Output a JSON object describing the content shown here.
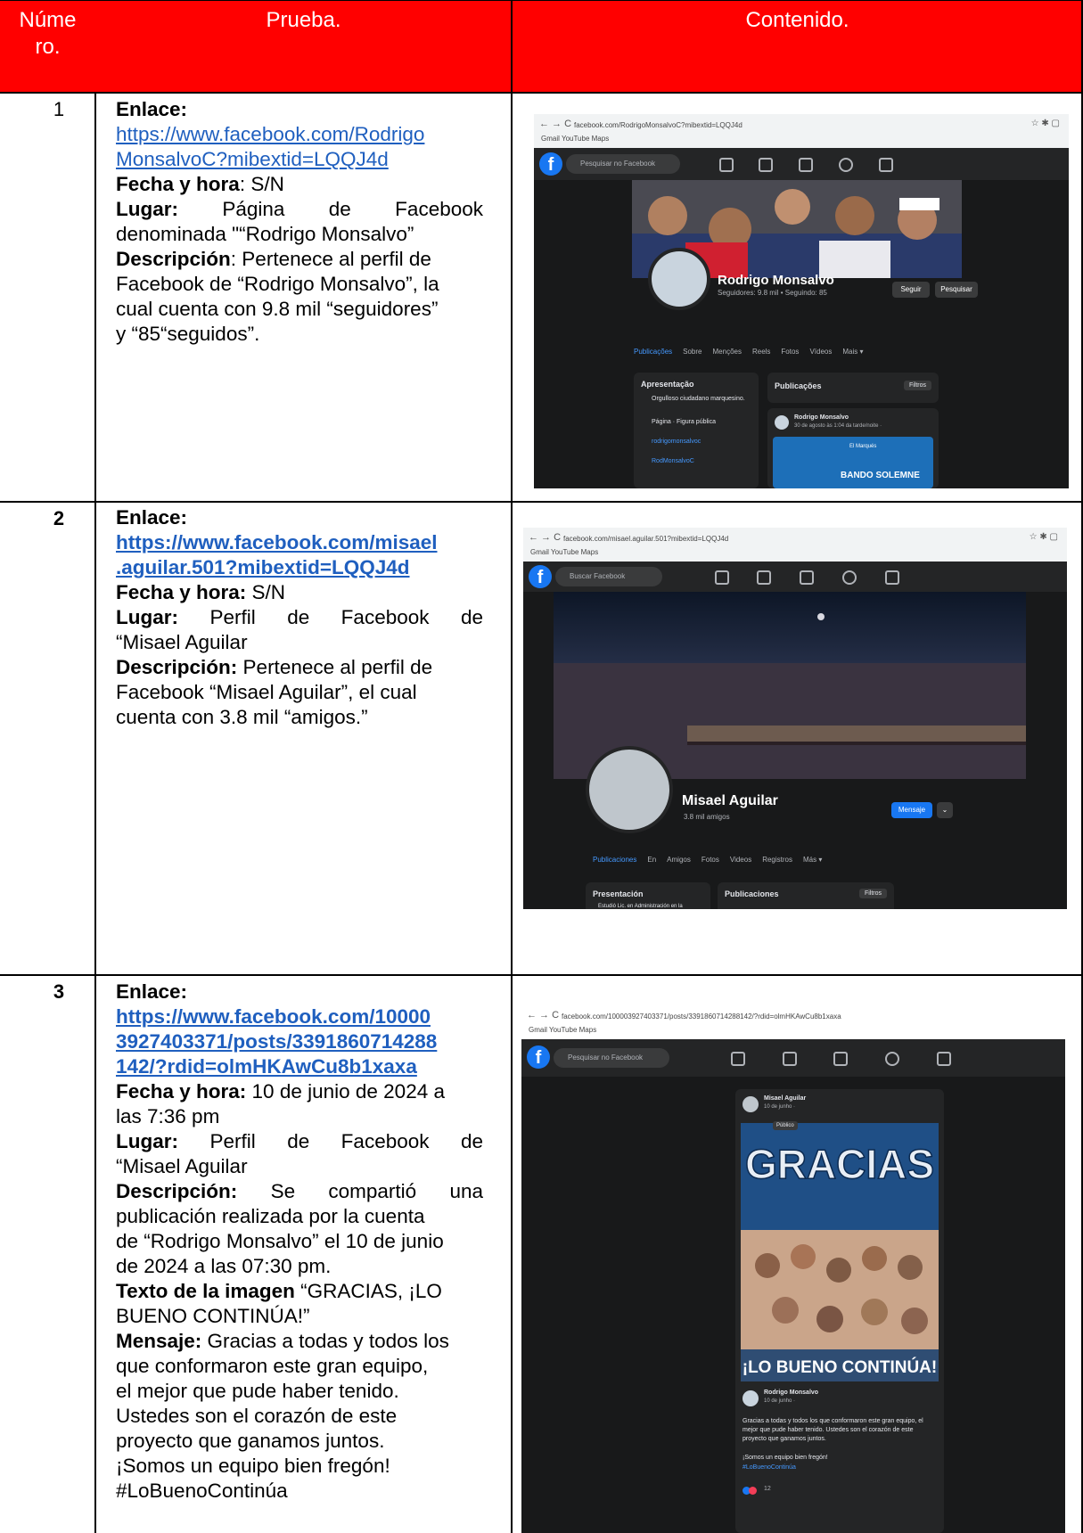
{
  "header": {
    "col_num": "Núme ro.",
    "col_num_l1": "Núme",
    "col_num_l2": "ro.",
    "col_prueba": "Prueba.",
    "col_contenido": "Contenido."
  },
  "rows": [
    {
      "number": "1",
      "enlace_label": "Enlace:",
      "link_line1": "https://www.facebook.com/Rodrigo",
      "link_line2": "MonsalvoC?mibextid=LQQJ4d",
      "fecha_label": "Fecha y hora",
      "fecha_value": ": S/N",
      "lugar_label": "Lugar:",
      "lugar_value": "Página de Facebook",
      "lugar_value2": "denominada \"“Rodrigo Monsalvo”",
      "desc_label": "Descripción",
      "desc_line1": ": Pertenece al perfil de",
      "desc_line2": "Facebook de “Rodrigo Monsalvo”, la",
      "desc_line3": "cual cuenta con 9.8 mil “seguidores”",
      "desc_line4": "y “85“seguidos”.",
      "screenshot": {
        "url": "facebook.com/RodrigoMonsalvoC?mibextid=LQQJ4d",
        "bookmarks": "Gmail   YouTube   Maps",
        "search": "Pesquisar no Facebook",
        "name": "Rodrigo Monsalvo",
        "sub": "Seguidores: 9.8 mil • Seguindo: 85",
        "btn_follow": "Seguir",
        "btn_search": "Pesquisar",
        "tabs": [
          "Publicações",
          "Sobre",
          "Menções",
          "Reels",
          "Fotos",
          "Vídeos",
          "Mais ▾"
        ],
        "intro_title": "Apresentação",
        "intro_text": "Orgulloso ciudadano marquesino.",
        "intro_items": [
          "Página · Figura pública",
          "rodrigomonsalvoc",
          "RodMonsalvoC"
        ],
        "posts_title": "Publicações",
        "filters": "Filtros",
        "post_author": "Rodrigo Monsalvo",
        "post_date": "30 de agosto às 1:04 da tarde/noite ·",
        "post_banner": "BANDO SOLEMNE",
        "post_logo": "El Marqués"
      }
    },
    {
      "number": "2",
      "enlace_label": "Enlace:",
      "link_line1": "https://www.facebook.com/misael",
      "link_line2": ".aguilar.501?mibextid=LQQJ4d",
      "fecha_label": "Fecha y hora:",
      "fecha_value": " S/N",
      "lugar_label": "Lugar:",
      "lugar_value": "Perfil de Facebook de",
      "lugar_value2": "“Misael Aguilar",
      "desc_label": "Descripción:",
      "desc_line1": " Pertenece al perfil de",
      "desc_line2": "Facebook “Misael Aguilar”, el cual",
      "desc_line3": "cuenta con 3.8 mil “amigos.”",
      "screenshot": {
        "url": "facebook.com/misael.aguilar.501?mibextid=LQQJ4d",
        "bookmarks": "Gmail   YouTube   Maps",
        "search": "Buscar Facebook",
        "name": "Misael Aguilar",
        "sub": "3.8 mil amigos",
        "btn_msg": "Mensaje",
        "tabs": [
          "Publicaciones",
          "En",
          "Amigos",
          "Fotos",
          "Videos",
          "Registros",
          "Más ▾"
        ],
        "intro_title": "Presentación",
        "intro_text": "Estudió Lic. en Administración en la",
        "posts_title": "Publicaciones",
        "filters": "Filtros"
      }
    },
    {
      "number": "3",
      "enlace_label": "Enlace:",
      "link_line1": "https://www.facebook.com/10000",
      "link_line2": "3927403371/posts/3391860714288",
      "link_line3": "142/?rdid=olmHKAwCu8b1xaxa",
      "fecha_label": "Fecha y hora:",
      "fecha_value": " 10 de junio de 2024 a",
      "fecha_value2": "las 7:36 pm",
      "lugar_label": "Lugar:",
      "lugar_value": "Perfil de Facebook de",
      "lugar_value2": "“Misael Aguilar",
      "desc_label": "Descripción:",
      "desc_line1": " Se compartió una",
      "desc_line2": "publicación realizada por la cuenta",
      "desc_line3": "de “Rodrigo Monsalvo” el 10 de junio",
      "desc_line4": "de 2024 a las 07:30 pm.",
      "texto_label": "Texto de la imagen",
      "texto_line1": " “GRACIAS, ¡LO",
      "texto_line2": "BUENO CONTINÚA!”",
      "mensaje_label": "Mensaje:",
      "mensaje_line1": " Gracias a todas y todos los",
      "mensaje_line2": "que conformaron este gran equipo,",
      "mensaje_line3": "el mejor que pude haber tenido.",
      "mensaje_line4": "Ustedes son el corazón de este",
      "mensaje_line5": "proyecto que ganamos juntos.",
      "mensaje_line6": "¡Somos un equipo bien fregón!",
      "mensaje_line7": "#LoBuenoContinúa",
      "screenshot": {
        "url": "facebook.com/100003927403371/posts/3391860714288142/?rdid=olmHKAwCu8b1xaxa",
        "bookmarks": "Gmail   YouTube   Maps",
        "search": "Pesquisar no Facebook",
        "share_author": "Misael Aguilar",
        "share_date": "10 de junho ·",
        "tooltip": "Público",
        "img_text1": "GRACIAS",
        "img_text2": "¡LO BUENO CONTINÚA!",
        "post_author": "Rodrigo Monsalvo",
        "post_date": "10 de junho ·",
        "post_text": "Gracias a todas y todos los que conformaron este gran equipo, el mejor que pude haber tenido. Ustedes son el corazón de este proyecto que ganamos juntos.",
        "post_text2": "¡Somos un equipo bien fregón!",
        "post_tag": "#LoBuenoContinúa",
        "reactions": "12"
      }
    }
  ]
}
